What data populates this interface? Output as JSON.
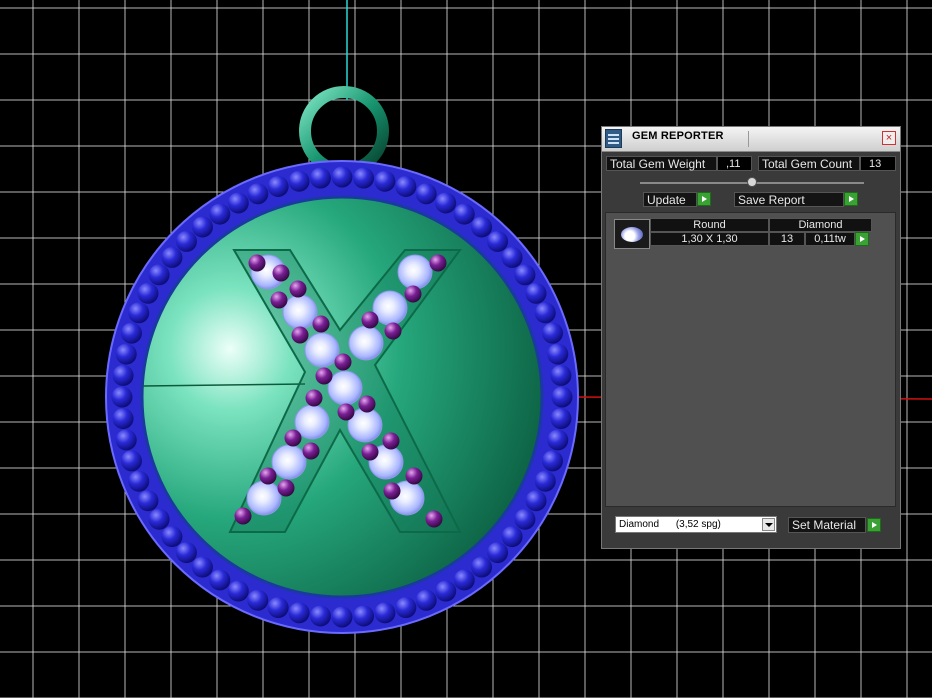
{
  "panel": {
    "title": "GEM REPORTER",
    "close_label": "×",
    "total_weight_label": "Total Gem Weight",
    "total_weight_value": ",11",
    "total_count_label": "Total Gem Count",
    "total_count_value": "13",
    "update_label": "Update",
    "save_report_label": "Save Report",
    "table": {
      "headers": [
        "Round",
        "Diamond"
      ],
      "row": {
        "size": "1,30 X 1,30",
        "count": "13",
        "weight": "0,11tw"
      }
    },
    "material_select": {
      "value": "Diamond",
      "detail": "(3,52 spg)"
    },
    "set_material_label": "Set Material"
  },
  "viewport": {
    "pendant_letter": "X",
    "colors": {
      "background": "#000000",
      "grid": "#d8d8d8",
      "pendant_body": "#1a9a70",
      "bezel_beads": "#2222cc",
      "bezel_ring": "#3a3ae0",
      "accent_stones": "#6a1a8a",
      "diamonds": "#b8c4ff",
      "axis_vertical": "#2ad8d8",
      "axis_horizontal": "#d01010"
    }
  }
}
